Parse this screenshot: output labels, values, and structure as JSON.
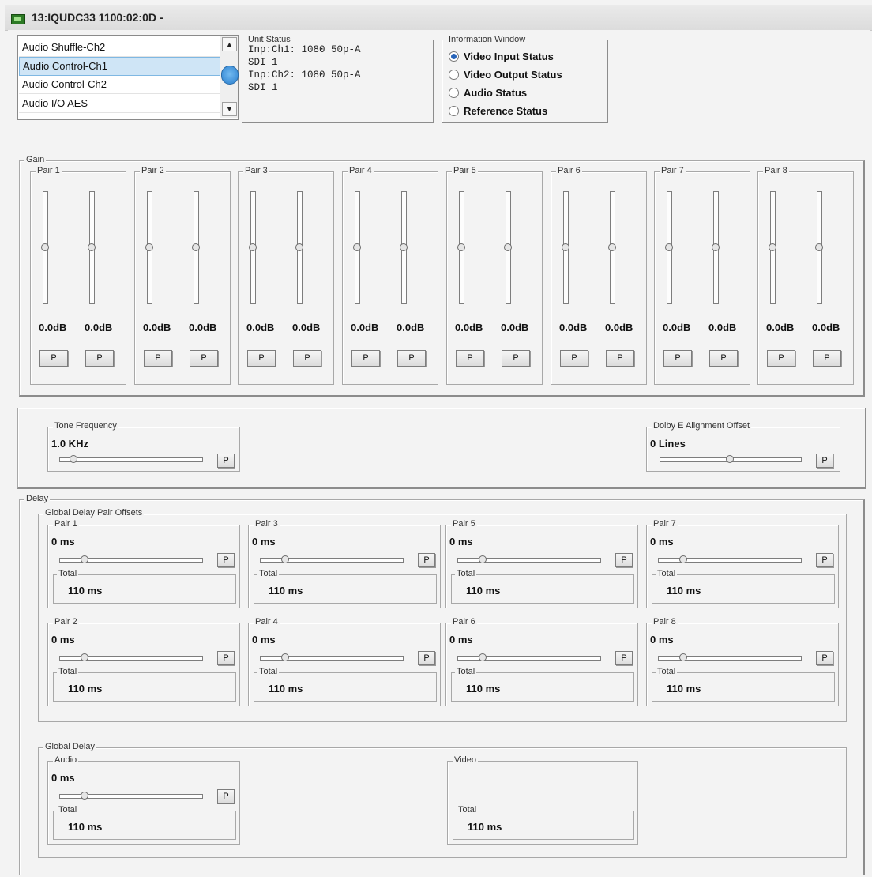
{
  "window": {
    "title": "13:IQUDC33  1100:02:0D  -"
  },
  "list": {
    "items": [
      "Audio Shuffle-Ch2",
      "Audio Control-Ch1",
      "Audio Control-Ch2",
      "Audio I/O AES"
    ],
    "selected_index": 1
  },
  "unit_status": {
    "title": "Unit Status",
    "lines": [
      "Inp:Ch1: 1080 50p-A",
      "SDI 1",
      "Inp:Ch2: 1080 50p-A",
      "SDI 1"
    ]
  },
  "info_window": {
    "title": "Information Window",
    "options": [
      "Video Input Status",
      "Video Output Status",
      "Audio Status",
      "Reference Status"
    ],
    "selected": 0
  },
  "gain": {
    "title": "Gain",
    "pairs": [
      {
        "label": "Pair 1",
        "left_db": "0.0dB",
        "right_db": "0.0dB"
      },
      {
        "label": "Pair 2",
        "left_db": "0.0dB",
        "right_db": "0.0dB"
      },
      {
        "label": "Pair 3",
        "left_db": "0.0dB",
        "right_db": "0.0dB"
      },
      {
        "label": "Pair 4",
        "left_db": "0.0dB",
        "right_db": "0.0dB"
      },
      {
        "label": "Pair 5",
        "left_db": "0.0dB",
        "right_db": "0.0dB"
      },
      {
        "label": "Pair 6",
        "left_db": "0.0dB",
        "right_db": "0.0dB"
      },
      {
        "label": "Pair 7",
        "left_db": "0.0dB",
        "right_db": "0.0dB"
      },
      {
        "label": "Pair 8",
        "left_db": "0.0dB",
        "right_db": "0.0dB"
      }
    ],
    "fader_level": 0.5,
    "p_label": "P"
  },
  "tone": {
    "title": "Tone Frequency",
    "value": "1.0 KHz",
    "slider_level": 0.1
  },
  "dolby": {
    "title": "Dolby E Alignment Offset",
    "value": "0 Lines",
    "slider_level": 0.5
  },
  "delay": {
    "title": "Delay",
    "global_pair_offsets_title": "Global Delay Pair Offsets",
    "total_label": "Total",
    "pairs": [
      {
        "label": "Pair 1",
        "value": "0 ms",
        "total": "110 ms"
      },
      {
        "label": "Pair 3",
        "value": "0 ms",
        "total": "110 ms"
      },
      {
        "label": "Pair 5",
        "value": "0 ms",
        "total": "110 ms"
      },
      {
        "label": "Pair 7",
        "value": "0 ms",
        "total": "110 ms"
      },
      {
        "label": "Pair 2",
        "value": "0 ms",
        "total": "110 ms"
      },
      {
        "label": "Pair 4",
        "value": "0 ms",
        "total": "110 ms"
      },
      {
        "label": "Pair 6",
        "value": "0 ms",
        "total": "110 ms"
      },
      {
        "label": "Pair 8",
        "value": "0 ms",
        "total": "110 ms"
      }
    ],
    "slider_level": 0.18,
    "global_delay": {
      "title": "Global Delay",
      "audio": {
        "title": "Audio",
        "value": "0 ms",
        "total": "110 ms"
      },
      "video": {
        "title": "Video",
        "total": "110 ms"
      }
    }
  }
}
